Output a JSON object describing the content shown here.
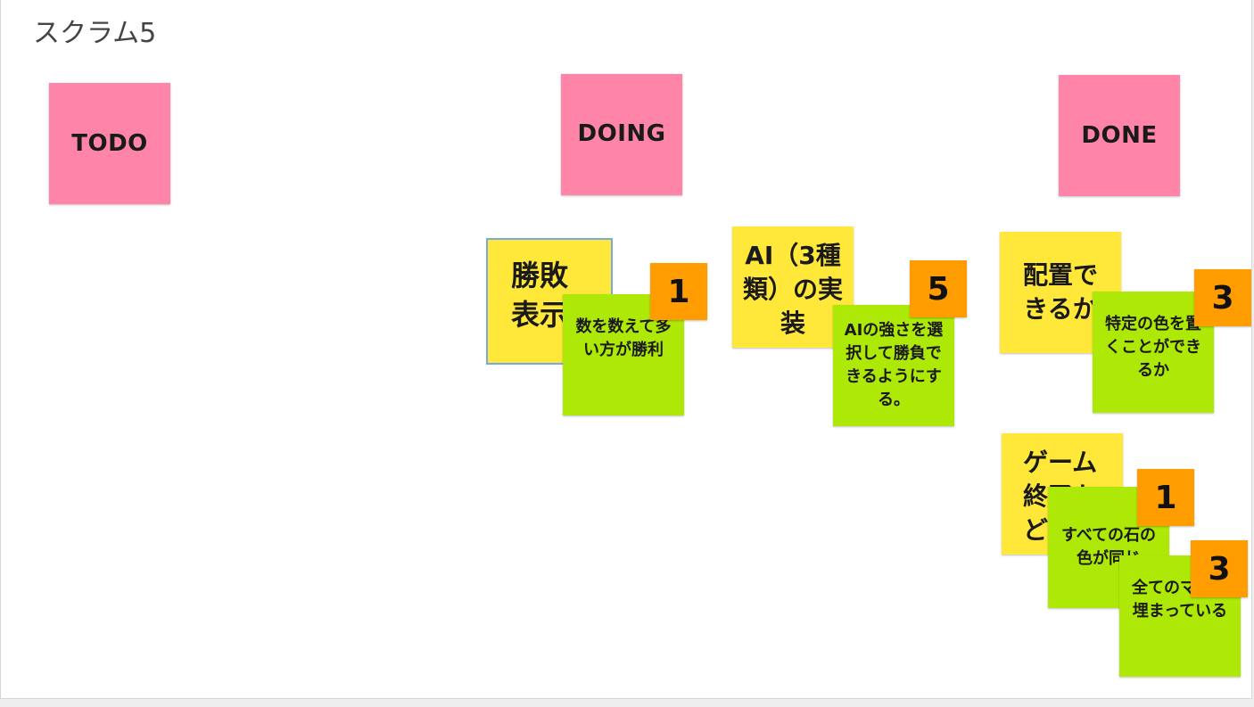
{
  "board": {
    "title": "スクラム5"
  },
  "columns": {
    "todo": "TODO",
    "doing": "DOING",
    "done": "DONE"
  },
  "doing": {
    "task1": {
      "title": "勝敗表示",
      "detail": "数を数えて多い方が勝利",
      "points": "1"
    },
    "task2": {
      "title": "AI（3種類）の実装",
      "detail": "AIの強さを選択して勝負できるようにする。",
      "points": "5"
    }
  },
  "done": {
    "task1": {
      "title": "配置できるか",
      "detail": "特定の色を置くことができるか",
      "points": "3"
    },
    "task2": {
      "title": "ゲーム終了かどうか",
      "detail_a": "すべての石の色が同じ",
      "points_a": "1",
      "detail_b": "全てのマスが埋まっている",
      "points_b": "3"
    }
  },
  "colors": {
    "header_note": "#ff85a8",
    "task_note": "#ffe83a",
    "detail_note": "#aee807",
    "points_note": "#ff9d00",
    "selection": "#78a8e8"
  }
}
